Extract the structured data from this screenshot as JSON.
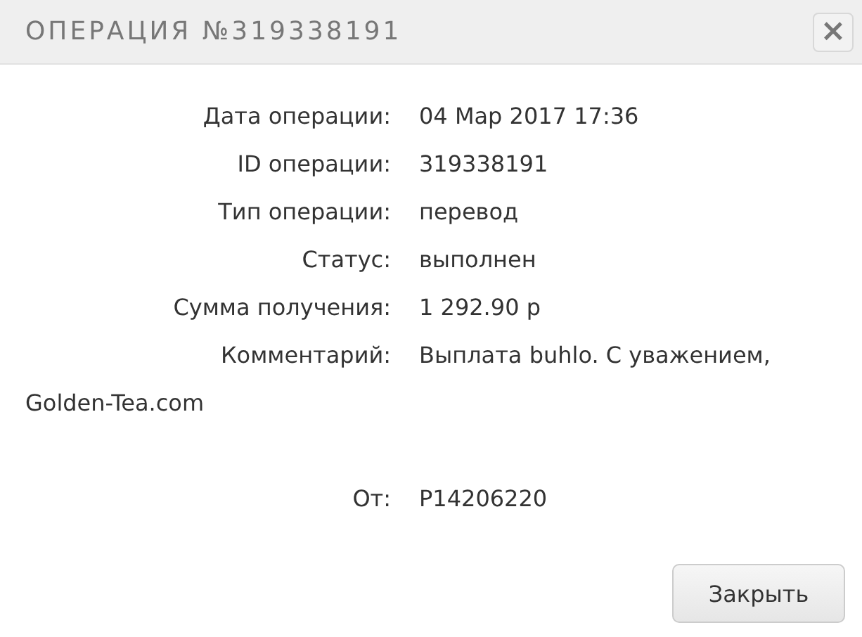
{
  "dialog": {
    "title": "ОПЕРАЦИЯ №319338191",
    "close_icon": "×"
  },
  "fields": [
    {
      "label": "Дата операции:",
      "value": "04 Мар 2017 17:36"
    },
    {
      "label": "ID операции:",
      "value": "319338191"
    },
    {
      "label": "Тип операции:",
      "value": "перевод"
    },
    {
      "label": "Статус:",
      "value": "выполнен"
    },
    {
      "label": "Сумма получения:",
      "value": "1 292.90 р"
    },
    {
      "label": "Комментарий:",
      "value": "Выплата buhlo. С уважением,",
      "continuation": "Golden-Tea.com"
    }
  ],
  "sender": {
    "label": "От:",
    "value": "P14206220"
  },
  "buttons": [
    "Закрыть"
  ]
}
